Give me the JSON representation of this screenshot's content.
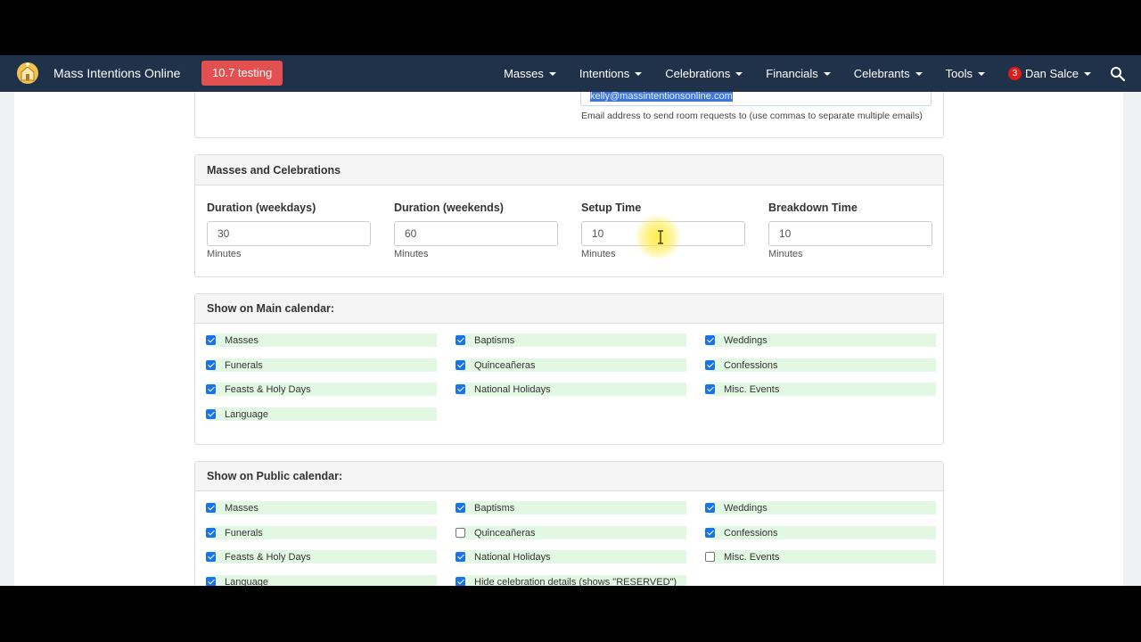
{
  "navbar": {
    "brand": "Mass Intentions Online",
    "test_badge": "10.7 testing",
    "menu": [
      {
        "label": "Masses"
      },
      {
        "label": "Intentions"
      },
      {
        "label": "Celebrations"
      },
      {
        "label": "Financials"
      },
      {
        "label": "Celebrants"
      },
      {
        "label": "Tools"
      }
    ],
    "user": {
      "notifications": "3",
      "name": "Dan Salce"
    },
    "colors": {
      "background": "#1f3249",
      "badge": "#e25050"
    }
  },
  "email_section": {
    "value": "kelly@massintentionsonline.com",
    "help": "Email address to send room requests to (use commas to separate multiple emails)"
  },
  "masses_panel": {
    "title": "Masses and Celebrations",
    "fields": [
      {
        "label": "Duration (weekdays)",
        "value": "30",
        "unit": "Minutes"
      },
      {
        "label": "Duration (weekends)",
        "value": "60",
        "unit": "Minutes"
      },
      {
        "label": "Setup Time",
        "value": "10",
        "unit": "Minutes"
      },
      {
        "label": "Breakdown Time",
        "value": "10",
        "unit": "Minutes"
      }
    ]
  },
  "main_calendar": {
    "title": "Show on Main calendar:",
    "items": [
      {
        "label": "Masses",
        "checked": true
      },
      {
        "label": "Baptisms",
        "checked": true
      },
      {
        "label": "Weddings",
        "checked": true
      },
      {
        "label": "Funerals",
        "checked": true
      },
      {
        "label": "Quinceañeras",
        "checked": true
      },
      {
        "label": "Confessions",
        "checked": true
      },
      {
        "label": "Feasts & Holy Days",
        "checked": true
      },
      {
        "label": "National Holidays",
        "checked": true
      },
      {
        "label": "Misc. Events",
        "checked": true
      },
      {
        "label": "Language",
        "checked": true
      }
    ]
  },
  "public_calendar": {
    "title": "Show on Public calendar:",
    "items": [
      {
        "label": "Masses",
        "checked": true
      },
      {
        "label": "Baptisms",
        "checked": true
      },
      {
        "label": "Weddings",
        "checked": true
      },
      {
        "label": "Funerals",
        "checked": true
      },
      {
        "label": "Quinceañeras",
        "checked": false
      },
      {
        "label": "Confessions",
        "checked": true
      },
      {
        "label": "Feasts & Holy Days",
        "checked": true
      },
      {
        "label": "National Holidays",
        "checked": true
      },
      {
        "label": "Misc. Events",
        "checked": false
      },
      {
        "label": "Language",
        "checked": true
      },
      {
        "label": "Hide celebration details (shows \"RESERVED\")",
        "checked": true
      }
    ]
  }
}
